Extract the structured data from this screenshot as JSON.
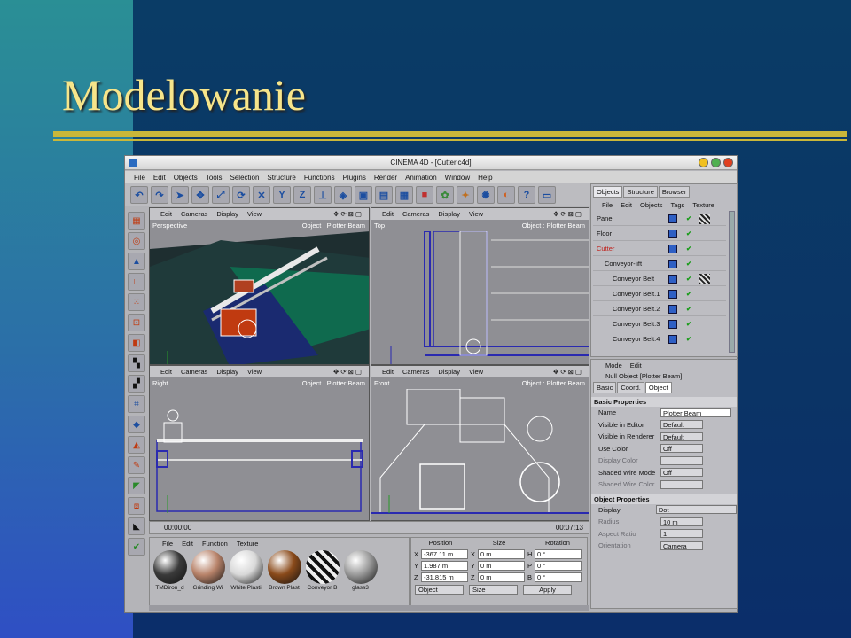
{
  "slide": {
    "title": "Modelowanie"
  },
  "window": {
    "title": "CINEMA 4D - [Cutter.c4d]"
  },
  "menu": [
    "File",
    "Edit",
    "Objects",
    "Tools",
    "Selection",
    "Structure",
    "Functions",
    "Plugins",
    "Render",
    "Animation",
    "Window",
    "Help"
  ],
  "toolbar_icons": [
    "undo-icon",
    "redo-icon",
    "pointer-icon",
    "move-icon",
    "scale-icon",
    "rotate-icon",
    "x-axis-icon",
    "y-axis-icon",
    "z-axis-icon",
    "coordsys-icon",
    "model-icon",
    "render-region-icon",
    "render-view-icon",
    "render-icon",
    "cube-icon",
    "nurbs-icon",
    "deformer-icon",
    "light-icon",
    "cloner-icon",
    "scene-icon",
    "camera-icon"
  ],
  "viewports": [
    {
      "name": "Perspective",
      "object": "Object : Plotter Beam",
      "menu": [
        "Edit",
        "Cameras",
        "Display",
        "View"
      ]
    },
    {
      "name": "Top",
      "object": "Object : Plotter Beam",
      "menu": [
        "Edit",
        "Cameras",
        "Display",
        "View"
      ]
    },
    {
      "name": "Right",
      "object": "Object : Plotter Beam",
      "menu": [
        "Edit",
        "Cameras",
        "Display",
        "View"
      ]
    },
    {
      "name": "Front",
      "object": "Object : Plotter Beam",
      "menu": [
        "Edit",
        "Cameras",
        "Display",
        "View"
      ]
    }
  ],
  "timeline": {
    "start": "00:00:00",
    "end": "00:07:13"
  },
  "materials": {
    "menu": [
      "File",
      "Edit",
      "Function",
      "Texture"
    ],
    "items": [
      {
        "name": "TMDiron_d",
        "color": "#3a3a3a"
      },
      {
        "name": "Grinding Wi",
        "color": "#b8836a"
      },
      {
        "name": "White Plasti",
        "color": "#d8d8d8"
      },
      {
        "name": "Brown Plast",
        "color": "#8a4a1a"
      },
      {
        "name": "Conveyor B",
        "color": "#222222"
      },
      {
        "name": "glass3",
        "color": "#9a9a9a"
      }
    ]
  },
  "coords": {
    "headers": [
      "Position",
      "Size",
      "Rotation"
    ],
    "rows": [
      {
        "a": "X",
        "pos": "-367.11 m",
        "b": "X",
        "size": "0 m",
        "c": "H",
        "rot": "0 °"
      },
      {
        "a": "Y",
        "pos": "1.987 m",
        "b": "Y",
        "size": "0 m",
        "c": "P",
        "rot": "0 °"
      },
      {
        "a": "Z",
        "pos": "-31.815 m",
        "b": "Z",
        "size": "0 m",
        "c": "B",
        "rot": "0 °"
      }
    ],
    "mode1": "Object",
    "mode2": "Size",
    "apply": "Apply"
  },
  "objects": {
    "tabs": [
      "Objects",
      "Structure",
      "Browser"
    ],
    "menu": [
      "File",
      "Edit",
      "Objects",
      "Tags",
      "Texture"
    ],
    "items": [
      {
        "name": "Pane",
        "indent": 0
      },
      {
        "name": "Floor",
        "indent": 0
      },
      {
        "name": "Cutter",
        "indent": 0,
        "color": "#c0201a"
      },
      {
        "name": "Conveyor-lift",
        "indent": 1
      },
      {
        "name": "Conveyor Belt",
        "indent": 2
      },
      {
        "name": "Conveyor Belt.1",
        "indent": 2
      },
      {
        "name": "Conveyor Belt.2",
        "indent": 2
      },
      {
        "name": "Conveyor Belt.3",
        "indent": 2
      },
      {
        "name": "Conveyor Belt.4",
        "indent": 2
      }
    ]
  },
  "attributes": {
    "menu": [
      "Mode",
      "Edit"
    ],
    "object": "Null Object [Plotter Beam]",
    "tabs": [
      "Basic",
      "Coord.",
      "Object"
    ],
    "basic_header": "Basic Properties",
    "basic": [
      {
        "label": "Name",
        "value": "Plotter Beam"
      },
      {
        "label": "Visible in Editor",
        "value": "Default"
      },
      {
        "label": "Visible in Renderer",
        "value": "Default"
      },
      {
        "label": "Use Color",
        "value": "Off"
      },
      {
        "label": "Display Color",
        "value": ""
      },
      {
        "label": "Shaded Wire Mode",
        "value": "Off"
      },
      {
        "label": "Shaded Wire Color",
        "value": ""
      }
    ],
    "object_header": "Object Properties",
    "object_props": [
      {
        "label": "Display",
        "value": "Dot"
      },
      {
        "label": "Radius",
        "value": "10 m"
      },
      {
        "label": "Aspect Ratio",
        "value": "1"
      },
      {
        "label": "Orientation",
        "value": "Camera"
      }
    ]
  },
  "colors": {
    "accent_title": "#f7e58a",
    "rule": "#c9b73a",
    "viewport_bg": "#8f8f94"
  }
}
